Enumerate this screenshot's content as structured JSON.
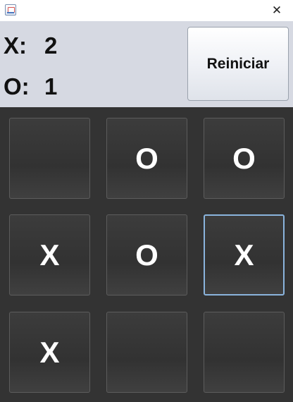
{
  "window": {
    "close_glyph": "✕",
    "app_icon": "java-icon"
  },
  "score": {
    "x_label": "X:",
    "x_value": "2",
    "o_label": "O:",
    "o_value": "1"
  },
  "reset_label": "Reiniciar",
  "board": {
    "cells": [
      "",
      "O",
      "O",
      "X",
      "O",
      "X",
      "X",
      "",
      ""
    ],
    "focused_cell": 5
  }
}
